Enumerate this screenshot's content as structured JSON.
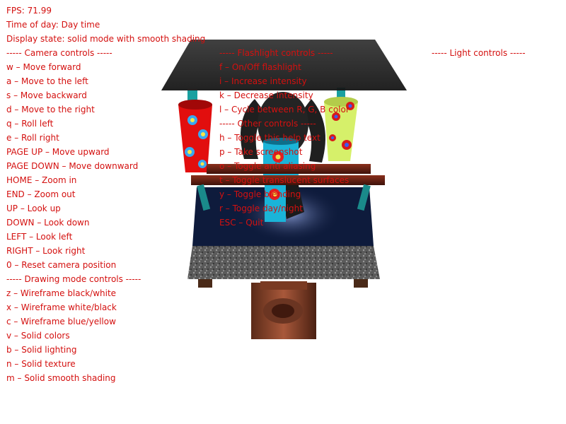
{
  "colors": {
    "hud_text": "#d4100f",
    "background": "#ffffff"
  },
  "hud": {
    "status": [
      "FPS: 71.99",
      "Time of day: Day time",
      "Display state: solid mode with smooth shading"
    ],
    "camera_controls": [
      "----- Camera controls -----",
      "w – Move forward",
      "a – Move to the left",
      "s – Move backward",
      "d – Move to the right",
      "q – Roll left",
      "e – Roll right",
      "PAGE UP – Move upward",
      "PAGE DOWN – Move downward",
      "HOME – Zoom in",
      "END – Zoom out",
      "UP – Look up",
      "DOWN – Look down",
      "LEFT – Look left",
      "RIGHT – Look right",
      "0 – Reset camera position"
    ],
    "drawing_controls": [
      "----- Drawing mode controls -----",
      "z – Wireframe black/white",
      "x – Wireframe white/black",
      "c – Wireframe blue/yellow",
      "v – Solid colors",
      "b – Solid lighting",
      "n – Solid texture",
      "m – Solid smooth shading"
    ],
    "flashlight_controls": [
      "----- Flashlight controls -----",
      "f – On/Off flashlight",
      "i – Increase intensity",
      "k – Decrease intensity",
      "l – Cycle between R, G, B color"
    ],
    "other_controls": [
      "----- Other controls -----",
      "h – Toggle this help text",
      "p – Take screenshot",
      "o – Toggle anti aliasing",
      "t – Toggle translucent surfaces",
      "y – Toggle blending",
      "r – Toggle day/night",
      "ESC – Quit"
    ],
    "light_controls": [
      "----- Light controls -----"
    ]
  }
}
